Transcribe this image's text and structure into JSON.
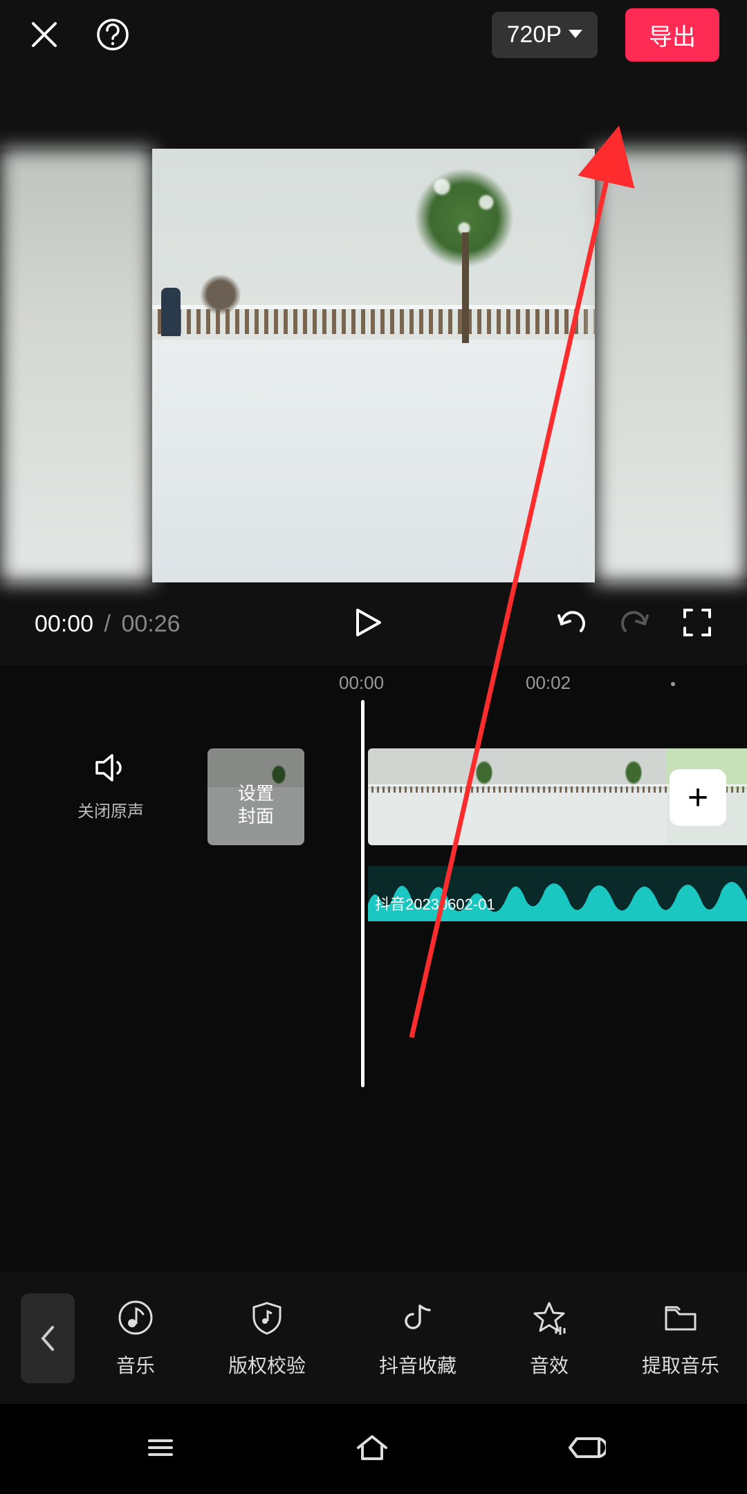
{
  "header": {
    "resolution_label": "720P",
    "export_label": "导出"
  },
  "playback": {
    "current_time": "00:00",
    "separator": "/",
    "duration": "00:26"
  },
  "ruler": {
    "t0": "00:00",
    "t1": "00:02"
  },
  "tracks": {
    "mute_label": "关闭原声",
    "cover_label": "设置\n封面",
    "audio_clip_name": "抖音20230602-01"
  },
  "toolbar": {
    "items": [
      {
        "id": "music",
        "label": "音乐"
      },
      {
        "id": "copyright",
        "label": "版权校验"
      },
      {
        "id": "douyin-fav",
        "label": "抖音收藏"
      },
      {
        "id": "sound-fx",
        "label": "音效"
      },
      {
        "id": "extract-music",
        "label": "提取音乐"
      }
    ]
  },
  "icons": {
    "add": "+"
  },
  "annotation": {
    "color": "#FE2C2C"
  }
}
